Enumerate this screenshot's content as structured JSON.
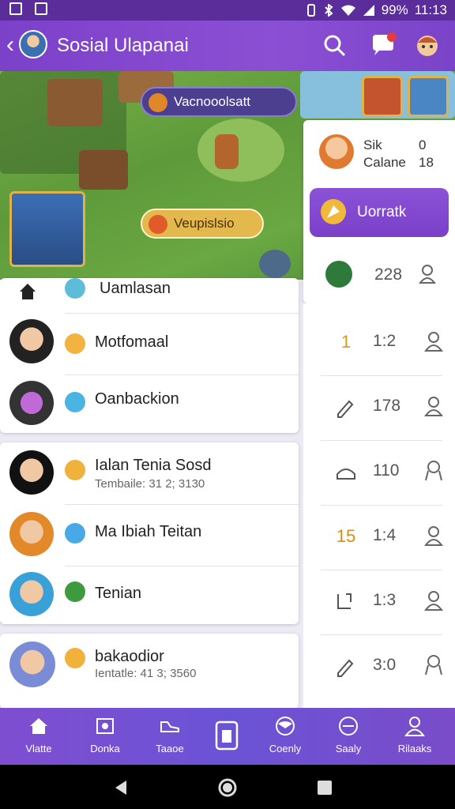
{
  "status_bar": {
    "battery": "99%",
    "time": "11:13"
  },
  "app_bar": {
    "title": "Sosial Ulapanai"
  },
  "hero": {
    "banner_top": "Vacnooolsatt",
    "banner_bottom": "Veupislsio"
  },
  "side_card": {
    "line1": "Sik",
    "line2": "Calane",
    "badge": "0",
    "count": "18",
    "action_label": "Uorratk",
    "stat_value": "228"
  },
  "list_rows": [
    {
      "name": "Uamlasan",
      "sub": ""
    },
    {
      "name": "Motfomaal",
      "sub": ""
    },
    {
      "name": "Oanbackion",
      "sub": ""
    },
    {
      "name": "Ialan Tenia Sosd",
      "sub": "Tembaile: 31 2; 3130"
    },
    {
      "name": "Ma Ibiah Teitan",
      "sub": ""
    },
    {
      "name": "Tenian",
      "sub": ""
    },
    {
      "name": "bakaodior",
      "sub": "Ientatle: 41 3; 3560"
    }
  ],
  "right_rows": [
    {
      "accent": "1",
      "value": "1:2",
      "accent_color": "#d49a1a"
    },
    {
      "accent": "",
      "value": "178",
      "accent_color": "#666666"
    },
    {
      "accent": "",
      "value": "110",
      "accent_color": "#666666"
    },
    {
      "accent": "15",
      "value": "1:4",
      "accent_color": "#e08a12"
    },
    {
      "accent": "",
      "value": "1:3",
      "accent_color": "#666666"
    },
    {
      "accent": "",
      "value": "3:0",
      "accent_color": "#666666"
    }
  ],
  "bottom_nav": [
    {
      "label": "Vlatte",
      "icon": "home-icon"
    },
    {
      "label": "Donka",
      "icon": "shield-icon"
    },
    {
      "label": "Taaoe",
      "icon": "shoe-icon"
    },
    {
      "label": "",
      "icon": "card-icon"
    },
    {
      "label": "Coenly",
      "icon": "globe-icon"
    },
    {
      "label": "Saaly",
      "icon": "coin-icon"
    },
    {
      "label": "Rilaaks",
      "icon": "profile-icon"
    }
  ],
  "colors": {
    "accent": "#7c41c9",
    "status_bar": "#5b2d9a",
    "nav": "#6b53d6"
  }
}
